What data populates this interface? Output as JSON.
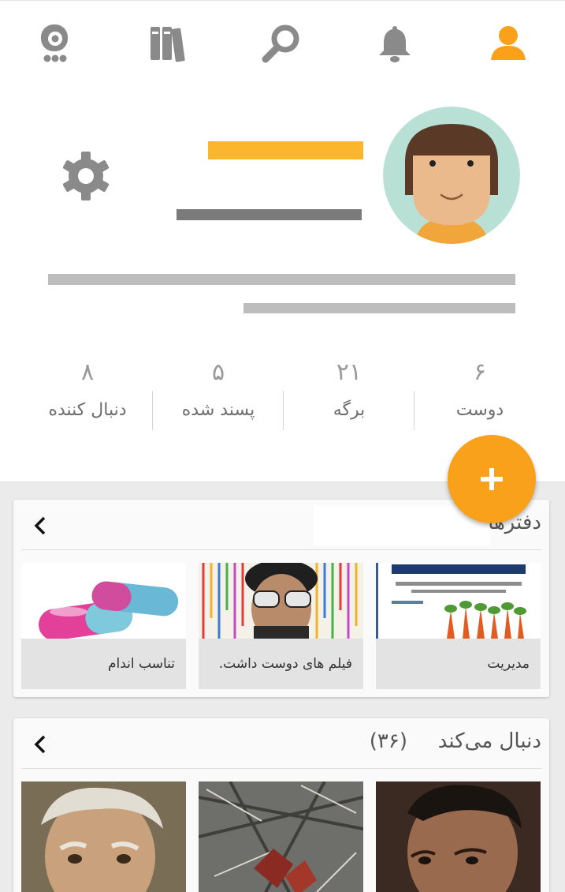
{
  "nav": {
    "items": [
      {
        "name": "profile-icon",
        "active": true
      },
      {
        "name": "notifications-icon",
        "active": false
      },
      {
        "name": "search-icon",
        "active": false
      },
      {
        "name": "library-icon",
        "active": false
      },
      {
        "name": "chat-bot-icon",
        "active": false
      }
    ],
    "active_color": "#f9a11b",
    "inactive_color": "#8a8a8a"
  },
  "profile": {
    "name_placeholder_color": "#fbb62e"
  },
  "stats": [
    {
      "value": "۶",
      "label": "دوست"
    },
    {
      "value": "۲۱",
      "label": "برگه"
    },
    {
      "value": "۵",
      "label": "پسند شده"
    },
    {
      "value": "۸",
      "label": "دنبال کننده"
    }
  ],
  "fab": {
    "label": "+",
    "color": "#f9a11b"
  },
  "notebooks": {
    "title": "دفترها",
    "items": [
      {
        "caption": "مدیریت"
      },
      {
        "caption": "فیلم های دوست داشت."
      },
      {
        "caption": "تناسب اندام"
      }
    ]
  },
  "following": {
    "title": "دنبال می‌کند",
    "count": "(۳۶)"
  }
}
